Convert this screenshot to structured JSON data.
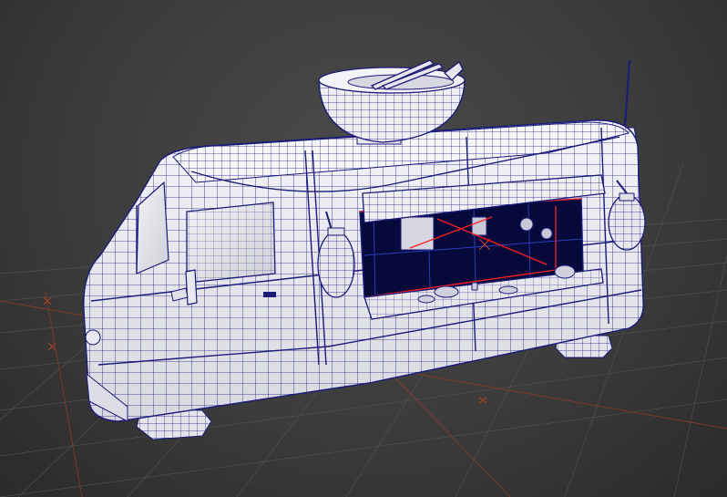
{
  "viewport": {
    "background_color": "#3d3d3d",
    "grid_color": "#555555",
    "grid_axis_color": "#8a3a2c",
    "wire_color": "#1a1a7a",
    "shade_color": "#ececf2",
    "selection_color": "#ff2020"
  },
  "scene": {
    "model": "food-truck",
    "parts": [
      "truck-body",
      "roof-bowl-prop",
      "chopsticks",
      "antenna",
      "front-lanterns",
      "rear-lantern",
      "side-mirror",
      "serving-window",
      "awning",
      "counter",
      "kitchen-interior",
      "front-wheel",
      "rear-wheel",
      "string-lights"
    ]
  }
}
